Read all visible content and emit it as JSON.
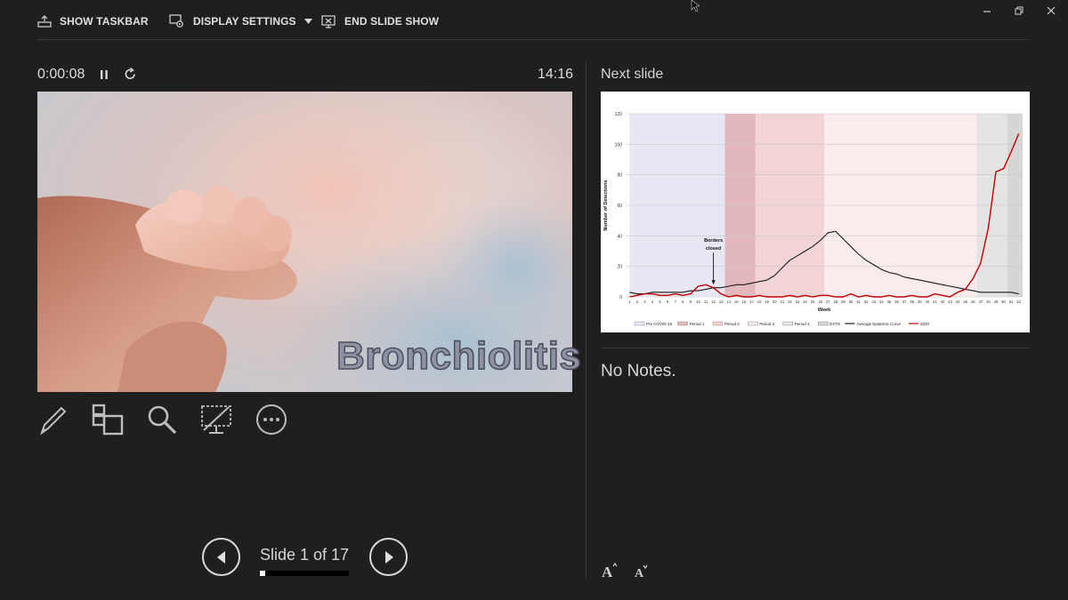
{
  "toolbar": {
    "show_taskbar": "SHOW TASKBAR",
    "display_settings": "DISPLAY SETTINGS",
    "end_slide_show": "END SLIDE SHOW"
  },
  "window_controls": [
    "minimize-icon",
    "restore-icon",
    "close-icon"
  ],
  "timer": {
    "elapsed": "0:00:08",
    "clock": "14:16"
  },
  "current_slide": {
    "title": "Bronchiolitis"
  },
  "tools": [
    "pen-icon",
    "see-all-slides-icon",
    "zoom-icon",
    "black-screen-icon",
    "more-options-icon"
  ],
  "navigation": {
    "slide_counter": "Slide 1 of 17",
    "progress": 0.06
  },
  "next_slide": {
    "header": "Next slide",
    "chart_data": {
      "type": "line",
      "title": "",
      "xlabel": "Week",
      "ylabel": "Number of Detections",
      "ylim": [
        0,
        120
      ],
      "yticks": [
        0,
        20,
        40,
        60,
        80,
        100,
        120
      ],
      "x": [
        1,
        2,
        3,
        4,
        5,
        6,
        7,
        8,
        9,
        10,
        11,
        12,
        13,
        14,
        15,
        16,
        17,
        18,
        19,
        20,
        21,
        22,
        23,
        24,
        25,
        26,
        27,
        28,
        29,
        30,
        31,
        32,
        33,
        34,
        35,
        36,
        37,
        38,
        39,
        40,
        41,
        42,
        43,
        44,
        45,
        46,
        47,
        48,
        49,
        50,
        51,
        52
      ],
      "annotation": {
        "text_line1": "Borders",
        "text_line2": "closed",
        "week": 12
      },
      "shaded_periods": [
        {
          "name": "Pre COVID-19",
          "from": 1,
          "to": 13.5,
          "color": "#e8e8f4"
        },
        {
          "name": "Period 1",
          "from": 13.5,
          "to": 17.5,
          "color": "#e2b8bc"
        },
        {
          "name": "Period 2",
          "from": 17.5,
          "to": 26.5,
          "color": "#f2d4d6"
        },
        {
          "name": "Period 3",
          "from": 26.5,
          "to": 46.5,
          "color": "#faeced"
        },
        {
          "name": "Period 4",
          "from": 46.5,
          "to": 50.5,
          "color": "#e4e4e4"
        },
        {
          "name": "EYTD",
          "from": 50.5,
          "to": 52.5,
          "color": "#d6d6d6"
        }
      ],
      "series": [
        {
          "name": "Average Epidemic Curve",
          "color": "#1a1a1a",
          "values": [
            3,
            2,
            2,
            3,
            3,
            3,
            3,
            3,
            4,
            4,
            5,
            6,
            6,
            7,
            8,
            8,
            9,
            10,
            11,
            14,
            19,
            24,
            27,
            30,
            33,
            37,
            42,
            43,
            38,
            33,
            28,
            24,
            21,
            18,
            16,
            15,
            13,
            12,
            11,
            10,
            9,
            8,
            7,
            6,
            5,
            4,
            3,
            3,
            3,
            3,
            3,
            2
          ]
        },
        {
          "name": "2020",
          "color": "#c00000",
          "values": [
            0,
            1,
            2,
            2,
            1,
            1,
            2,
            1,
            2,
            7,
            8,
            6,
            2,
            0,
            1,
            0,
            0,
            1,
            0,
            0,
            0,
            1,
            0,
            1,
            0,
            1,
            1,
            0,
            0,
            2,
            0,
            1,
            0,
            0,
            1,
            0,
            0,
            1,
            0,
            0,
            2,
            1,
            0,
            3,
            5,
            12,
            22,
            45,
            82,
            84,
            95,
            107
          ]
        }
      ]
    }
  },
  "notes": {
    "text": "No Notes."
  },
  "font_controls": [
    "increase-font-icon",
    "decrease-font-icon"
  ]
}
